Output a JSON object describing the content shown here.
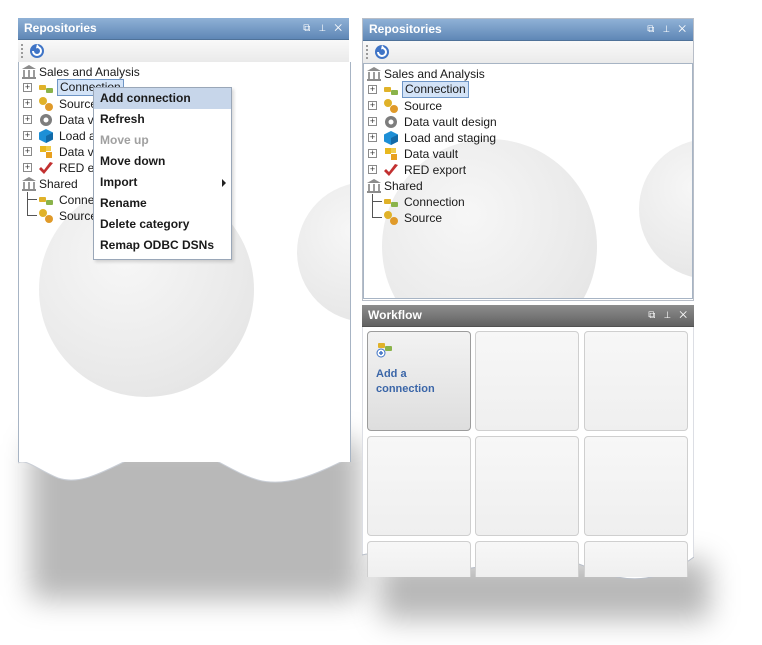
{
  "left_panel": {
    "title": "Repositories",
    "title_buttons": [
      "⧉",
      "⊥",
      "✕"
    ],
    "tree": {
      "root_group": "Sales and Analysis",
      "items": [
        {
          "label": "Connection",
          "icon": "connection-icon",
          "selected": true
        },
        {
          "label": "Source",
          "icon": "source-icon"
        },
        {
          "label": "Data vault design",
          "icon": "gear-icon"
        },
        {
          "label": "Load and staging",
          "icon": "cube-icon"
        },
        {
          "label": "Data vault",
          "icon": "datavault-icon"
        },
        {
          "label": "RED export",
          "icon": "export-icon"
        }
      ],
      "shared_group": "Shared",
      "shared_items": [
        {
          "label": "Connection",
          "icon": "connection-icon"
        },
        {
          "label": "Source",
          "icon": "source-icon"
        }
      ]
    },
    "truncated_labels": [
      "Connection",
      "Source",
      "Data v",
      "Load a",
      "Data v",
      "RED e",
      "Conne",
      "Source"
    ]
  },
  "context_menu": {
    "items": [
      {
        "label": "Add connection",
        "state": "highlighted"
      },
      {
        "label": "Refresh",
        "state": "normal"
      },
      {
        "label": "Move up",
        "state": "disabled"
      },
      {
        "label": "Move down",
        "state": "normal"
      },
      {
        "label": "Import",
        "state": "normal",
        "submenu": true
      },
      {
        "label": "Rename",
        "state": "normal"
      },
      {
        "label": "Delete category",
        "state": "normal"
      },
      {
        "label": "Remap ODBC DSNs",
        "state": "normal"
      }
    ]
  },
  "right_panel": {
    "title": "Repositories",
    "title_buttons": [
      "⧉",
      "⊥",
      "✕"
    ]
  },
  "workflow_panel": {
    "title": "Workflow",
    "title_buttons": [
      "⧉",
      "⊥",
      "✕"
    ],
    "tiles": [
      {
        "label": "Add a connection",
        "icon": "add-connection-icon"
      }
    ]
  },
  "colors": {
    "title_blue": "#5f87b6",
    "title_gray": "#626262",
    "menu_highlight": "#c7d6ea",
    "link_blue": "#3b66a8"
  }
}
